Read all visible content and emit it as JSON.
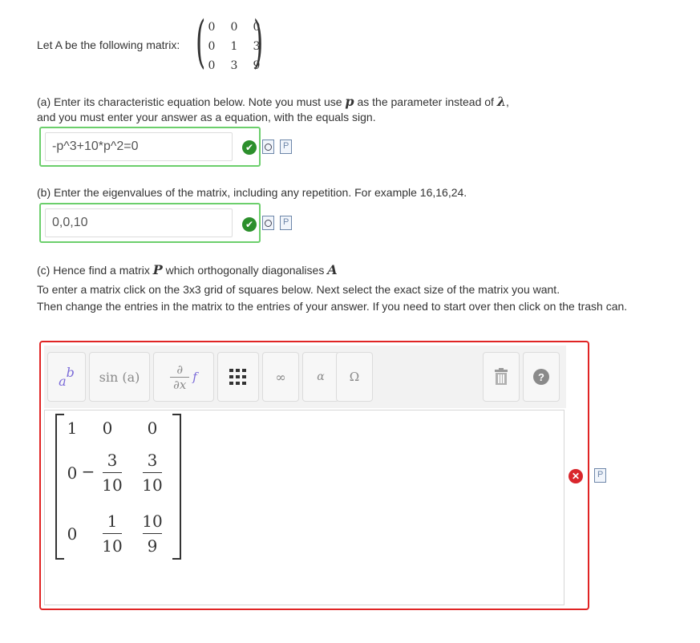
{
  "intro": {
    "text": "Let A be the following matrix:"
  },
  "given_matrix": [
    [
      "0",
      "0",
      "0"
    ],
    [
      "0",
      "1",
      "3"
    ],
    [
      "0",
      "3",
      "9"
    ]
  ],
  "part_a": {
    "line1": "(a) Enter its characteristic equation below. Note you must use",
    "var_p": "p",
    "line1_rest": "as the parameter instead of",
    "lambda": "λ",
    "line1_end": ",",
    "line2": "and you must enter your answer as a equation, with the equals sign.",
    "answer": "-p^3+10*p^2=0"
  },
  "part_b": {
    "line1": "(b) Enter the eigenvalues of the matrix, including any repetition. For example 16,16,24.",
    "answer": "0,0,10"
  },
  "part_c": {
    "line1_a": "(c) Hence find a matrix",
    "var_P": "P",
    "line1_b": "which orthogonally diagonalises",
    "var_A": "A",
    "line2": "To enter a matrix click on the 3x3 grid of squares below. Next select the exact size of the matrix you want.",
    "line3": "Then change the entries in the matrix to the entries of your answer. If you need to start over then click on the trash can."
  },
  "toolbar": {
    "superscript_label": "a",
    "superscript_exp": "b",
    "function_label": "sin (a)",
    "deriv_num": "∂",
    "deriv_den": "∂x",
    "deriv_f": "f",
    "infinity": "∞",
    "alpha": "α",
    "omega": "Ω",
    "help": "?"
  },
  "answer_matrix": {
    "row1": {
      "c1": "1",
      "c2": "0",
      "c3": "0"
    },
    "row2": {
      "c1": "0",
      "c2_sign": "−",
      "c2_num": "3",
      "c2_den": "10",
      "c3_num": "3",
      "c3_den": "10"
    },
    "row3": {
      "c1": "0",
      "c2_num": "1",
      "c2_den": "10",
      "c3_num": "10",
      "c3_den": "9"
    }
  },
  "status": {
    "correct_color": "#2c8f2c",
    "wrong_color": "#d9262c",
    "correct_box_color": "#6ccf6c",
    "wrong_box_color": "#e02424"
  }
}
